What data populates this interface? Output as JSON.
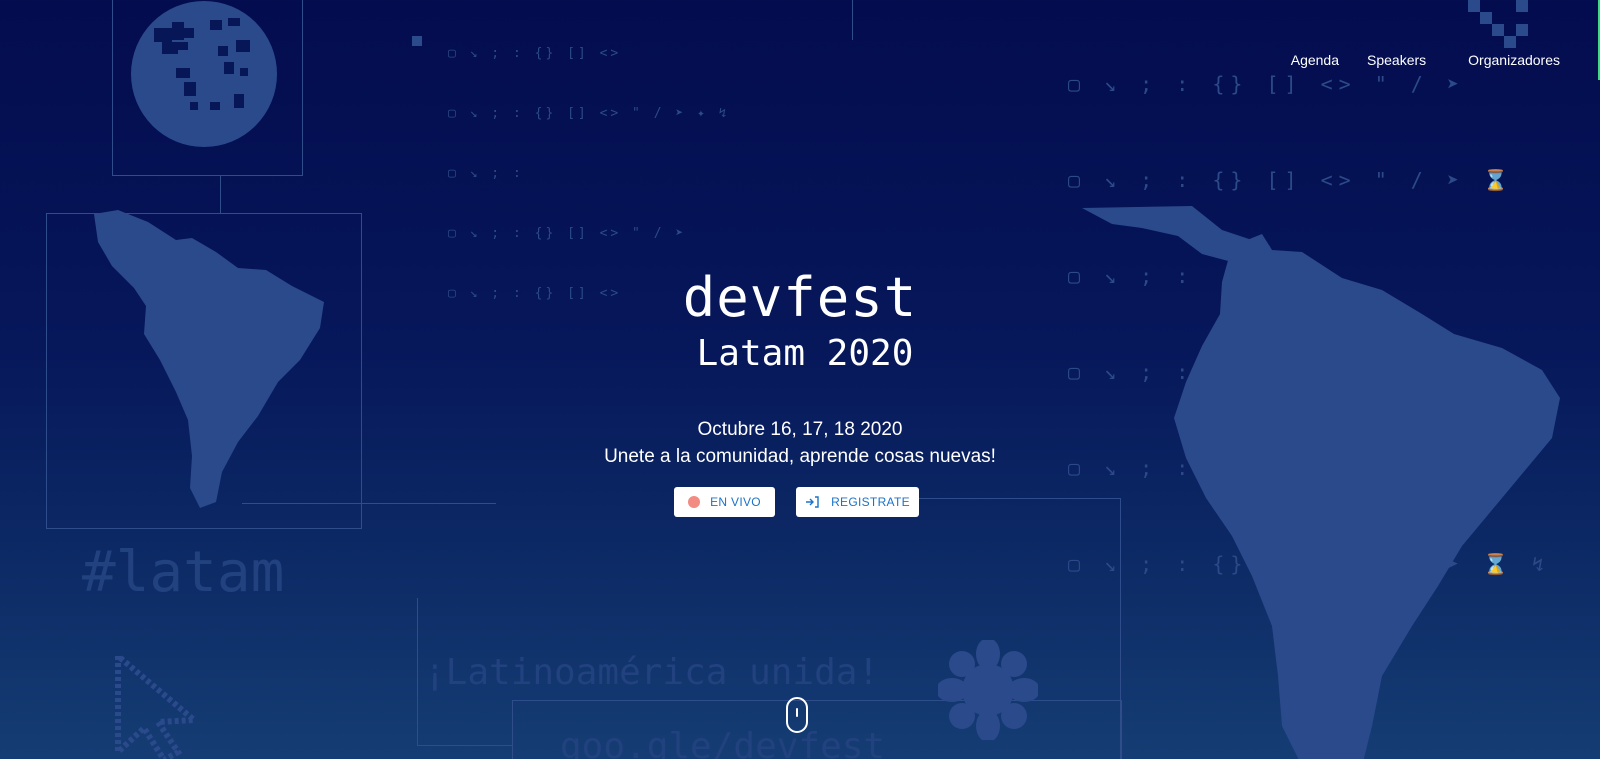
{
  "nav": {
    "items": [
      {
        "label": "Agenda"
      },
      {
        "label": "Speakers"
      },
      {
        "label": "Organizadores"
      }
    ]
  },
  "hero": {
    "logo_line1": "devfest",
    "logo_line2": "Latam 2020",
    "dates": "Octubre 16, 17, 18  2020",
    "tagline": "Unete a la comunidad, aprende cosas nuevas!",
    "live_button": "EN VIVO",
    "register_button": "REGISTRATE"
  },
  "decor": {
    "hashtag": "#latam",
    "slogan": "¡Latinoamérica unida!",
    "short_link": "goo.gle/devfest"
  },
  "icons": [
    "globe-icon",
    "south-america-map",
    "pointer-cursor-icon",
    "flower-icon",
    "register-icon",
    "live-dot-icon",
    "mouse-scroll-icon"
  ],
  "colors": {
    "background_top": "#030c4e",
    "background_bottom": "#153d74",
    "decor": "#2c4a88",
    "button_text": "#1a73c8",
    "live_dot": "#f28b82"
  }
}
